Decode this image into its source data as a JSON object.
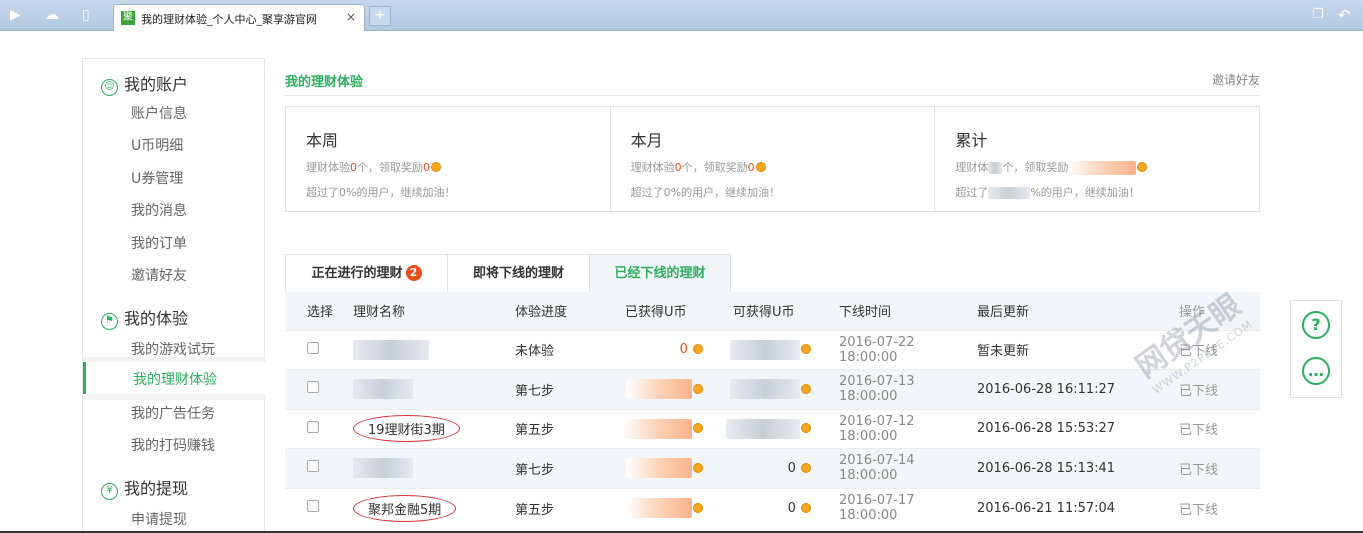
{
  "browser": {
    "tab_title": "我的理财体验_个人中心_聚享游官网",
    "tab_close": "×",
    "new_tab": "+",
    "favicon_char": "聚"
  },
  "sidebar": {
    "sections": [
      {
        "title": "我的账户",
        "icon": "user-icon",
        "items": [
          "账户信息",
          "U币明细",
          "U券管理",
          "我的消息",
          "我的订单",
          "邀请好友"
        ]
      },
      {
        "title": "我的体验",
        "icon": "flag-icon",
        "items": [
          "我的游戏试玩",
          "我的理财体验",
          "我的广告任务",
          "我的打码赚钱"
        ]
      },
      {
        "title": "我的提现",
        "icon": "yen-icon",
        "items": [
          "申请提现"
        ]
      }
    ],
    "active_item": "我的理财体验"
  },
  "main": {
    "title": "我的理财体验",
    "invite": "邀请好友",
    "stats": [
      {
        "title": "本周",
        "line1_a": "理财体验",
        "count": "0",
        "line1_b": "个，领取奖励",
        "reward": "0",
        "line2": "超过了0%的用户，继续加油！"
      },
      {
        "title": "本月",
        "line1_a": "理财体验",
        "count": "0",
        "line1_b": "个，领取奖励",
        "reward": "0",
        "line2": "超过了0%的用户，继续加油！"
      },
      {
        "title": "累计",
        "line1_a": "理财体",
        "count": "",
        "line1_b": "个，领取奖励",
        "reward": "",
        "line2_a": "超过了",
        "line2_b": "%的用户，继续加油！"
      }
    ],
    "tabs": [
      {
        "label": "正在进行的理财",
        "badge": "2"
      },
      {
        "label": "即将下线的理财"
      },
      {
        "label": "已经下线的理财"
      }
    ],
    "active_tab": "已经下线的理财",
    "table": {
      "headers": [
        "选择",
        "理财名称",
        "体验进度",
        "已获得U币",
        "可获得U币",
        "下线时间",
        "最后更新",
        "操作"
      ],
      "rows": [
        {
          "name": "",
          "progress": "未体验",
          "got": "0",
          "can": "",
          "offline": "2016-07-22 18:00:00",
          "updated": "暂未更新",
          "op": "已下线"
        },
        {
          "name": "",
          "progress": "第七步",
          "got": "",
          "can": "",
          "offline": "2016-07-13 18:00:00",
          "updated": "2016-06-28 16:11:27",
          "op": "已下线"
        },
        {
          "name": "19理财街3期",
          "progress": "第五步",
          "got": "",
          "can": "",
          "offline": "2016-07-12 18:00:00",
          "updated": "2016-06-28 15:53:27",
          "op": "已下线"
        },
        {
          "name": "",
          "progress": "第七步",
          "got": "",
          "can": "0",
          "offline": "2016-07-14 18:00:00",
          "updated": "2016-06-28 15:13:41",
          "op": "已下线"
        },
        {
          "name": "聚邦金融5期",
          "progress": "第五步",
          "got": "",
          "can": "0",
          "offline": "2016-07-17 18:00:00",
          "updated": "2016-06-21 11:57:04",
          "op": "已下线"
        }
      ]
    }
  },
  "float_buttons": [
    {
      "icon": "help-icon",
      "glyph": "?"
    },
    {
      "icon": "chat-icon",
      "glyph": "…"
    }
  ],
  "watermark": {
    "text": "网贷天眼",
    "sub": "WWW.P2PEYE.COM"
  },
  "colors": {
    "accent": "#2daf5f",
    "highlight": "#e94e1b",
    "annotation": "#d9363e"
  }
}
